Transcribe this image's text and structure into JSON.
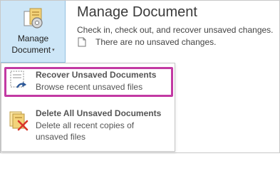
{
  "manage_button": {
    "line1": "Manage",
    "line2": "Document",
    "caret": "▾",
    "icon": "manage-document-icon"
  },
  "info": {
    "title": "Manage Document",
    "description": "Check in, check out, and recover unsaved changes.",
    "status": "There are no unsaved changes.",
    "status_icon": "document-icon"
  },
  "menu": {
    "items": [
      {
        "title": "Recover Unsaved Documents",
        "sub": [
          "Browse recent unsaved files"
        ],
        "icon": "recover-documents-icon"
      },
      {
        "title": "Delete All Unsaved Documents",
        "sub": [
          "Delete all recent copies of",
          "unsaved files"
        ],
        "icon": "delete-documents-icon"
      }
    ]
  },
  "colors": {
    "button_bg": "#cde6f7",
    "highlight": "#c23aa3",
    "accent_blue": "#2b5797",
    "delete_red": "#d9362a"
  }
}
